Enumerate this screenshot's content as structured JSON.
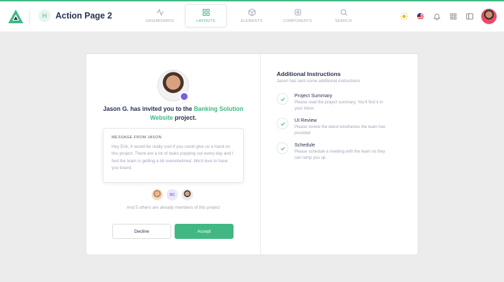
{
  "header": {
    "page_avatar_initial": "H",
    "page_title": "Action Page 2",
    "nav": [
      {
        "label": "DASHBOARDS",
        "icon": "activity-icon"
      },
      {
        "label": "LAYOUTS",
        "icon": "grid-icon"
      },
      {
        "label": "ELEMENTS",
        "icon": "box-icon"
      },
      {
        "label": "COMPONENTS",
        "icon": "settings-icon"
      },
      {
        "label": "SEARCH",
        "icon": "search-icon"
      }
    ],
    "active_nav": "LAYOUTS",
    "right_icons": [
      "sun-icon",
      "us-flag-icon",
      "bell-icon",
      "apps-grid-icon",
      "sidebar-icon",
      "user-avatar"
    ]
  },
  "invite": {
    "prefix": "Jason G. has invited you to the ",
    "project": "Banking Solution Website",
    "suffix": " project."
  },
  "message": {
    "heading": "MESSAGE FROM JASON",
    "body": "Hey Erik, It would be really cool if you could give us a hand on this project. There are a lot of tasks popping out every day and I feel the team is getting a bit overwhelmed. We'd love to have you board."
  },
  "members": {
    "initials": "SC",
    "others_text": "And 5 others are already members of this project"
  },
  "buttons": {
    "decline": "Decline",
    "accept": "Accept"
  },
  "instructions": {
    "title": "Additional Instructions",
    "subtitle": "Jason has sent some additional instructions",
    "steps": [
      {
        "title": "Project Summary",
        "desc": "Please read the project summary. You'll find it in your inbox"
      },
      {
        "title": "UI Review",
        "desc": "Please review the latest wireframes the team has provided"
      },
      {
        "title": "Schedule",
        "desc": "Please schedule a meeting with the team so they can ramp you up."
      }
    ]
  },
  "colors": {
    "accent": "#41b883",
    "text": "#283252",
    "muted": "#a2a5b9",
    "background": "#ececec"
  }
}
